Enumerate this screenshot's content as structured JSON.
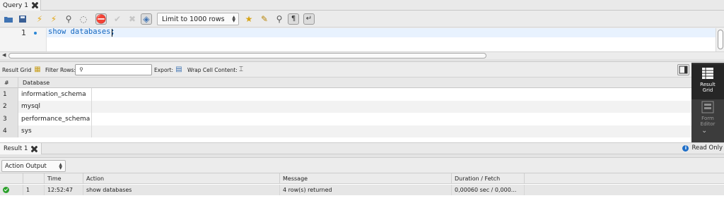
{
  "query_tab": {
    "label": "Query 1"
  },
  "toolbar": {
    "icons": [
      "open-folder",
      "save",
      "execute",
      "execute-current",
      "explain",
      "stop",
      "toggle-stop-on-error",
      "commit",
      "rollback",
      "autocommit"
    ],
    "limit_select": "Limit to 1000 rows",
    "icons_right": [
      "add-snippet",
      "beautify",
      "find",
      "invisible-chars",
      "wrap-lines"
    ]
  },
  "editor": {
    "line_number": "1",
    "code": "show databases;"
  },
  "result_toolbar": {
    "result_grid_label": "Result Grid",
    "filter_rows_label": "Filter Rows:",
    "filter_value": "",
    "export_label": "Export:",
    "wrap_label": "Wrap Cell Content:"
  },
  "result_grid": {
    "headers": [
      "#",
      "Database"
    ],
    "rows": [
      {
        "n": "1",
        "database": "information_schema"
      },
      {
        "n": "2",
        "database": "mysql"
      },
      {
        "n": "3",
        "database": "performance_schema"
      },
      {
        "n": "4",
        "database": "sys"
      }
    ]
  },
  "side_panel": {
    "result_grid": "Result\nGrid",
    "form_editor": "Form\nEditor"
  },
  "result_tabs": {
    "tab_label": "Result 1",
    "read_only": "Read Only"
  },
  "action_output": {
    "select_label": "Action Output",
    "headers": [
      "",
      "Time",
      "Action",
      "Message",
      "Duration / Fetch"
    ],
    "rows": [
      {
        "n": "1",
        "time": "12:52:47",
        "action": "show databases",
        "message": "4 row(s) returned",
        "duration": "0,00060 sec / 0,000..."
      }
    ]
  },
  "colors": {
    "accent": "#2a86d5",
    "ok": "#2ba12b",
    "side_panel": "#3c3c3c"
  }
}
